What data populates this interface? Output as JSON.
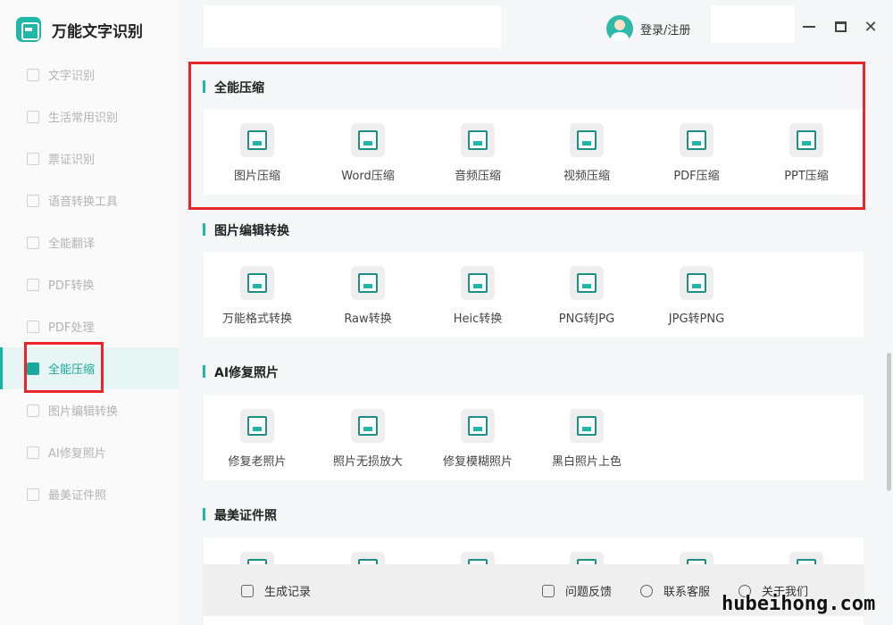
{
  "app": {
    "name": "万能文字识别"
  },
  "sidebar": {
    "items": [
      {
        "label": "文字识别",
        "active": false
      },
      {
        "label": "生活常用识别",
        "active": false
      },
      {
        "label": "票证识别",
        "active": false
      },
      {
        "label": "语音转换工具",
        "active": false
      },
      {
        "label": "全能翻译",
        "active": false
      },
      {
        "label": "PDF转换",
        "active": false
      },
      {
        "label": "PDF处理",
        "active": false
      },
      {
        "label": "全能压缩",
        "active": true
      },
      {
        "label": "图片编辑转换",
        "active": false
      },
      {
        "label": "AI修复照片",
        "active": false
      },
      {
        "label": "最美证件照",
        "active": false
      }
    ]
  },
  "header": {
    "login_label": "登录/注册"
  },
  "sections": [
    {
      "title": "全能压缩",
      "tiles": [
        "图片压缩",
        "Word压缩",
        "音频压缩",
        "视频压缩",
        "PDF压缩",
        "PPT压缩"
      ]
    },
    {
      "title": "图片编辑转换",
      "tiles": [
        "万能格式转换",
        "Raw转换",
        "Heic转换",
        "PNG转JPG",
        "JPG转PNG"
      ]
    },
    {
      "title": "AI修复照片",
      "tiles": [
        "修复老照片",
        "照片无损放大",
        "修复模糊照片",
        "黑白照片上色"
      ]
    },
    {
      "title": "最美证件照",
      "tiles": []
    }
  ],
  "footer": {
    "history": "生成记录",
    "feedback": "问题反馈",
    "support": "联系客服",
    "about": "关于我们"
  },
  "watermark": "hubeihong.com",
  "colors": {
    "accent": "#1fb7a8",
    "highlight_box": "#e8262a"
  }
}
